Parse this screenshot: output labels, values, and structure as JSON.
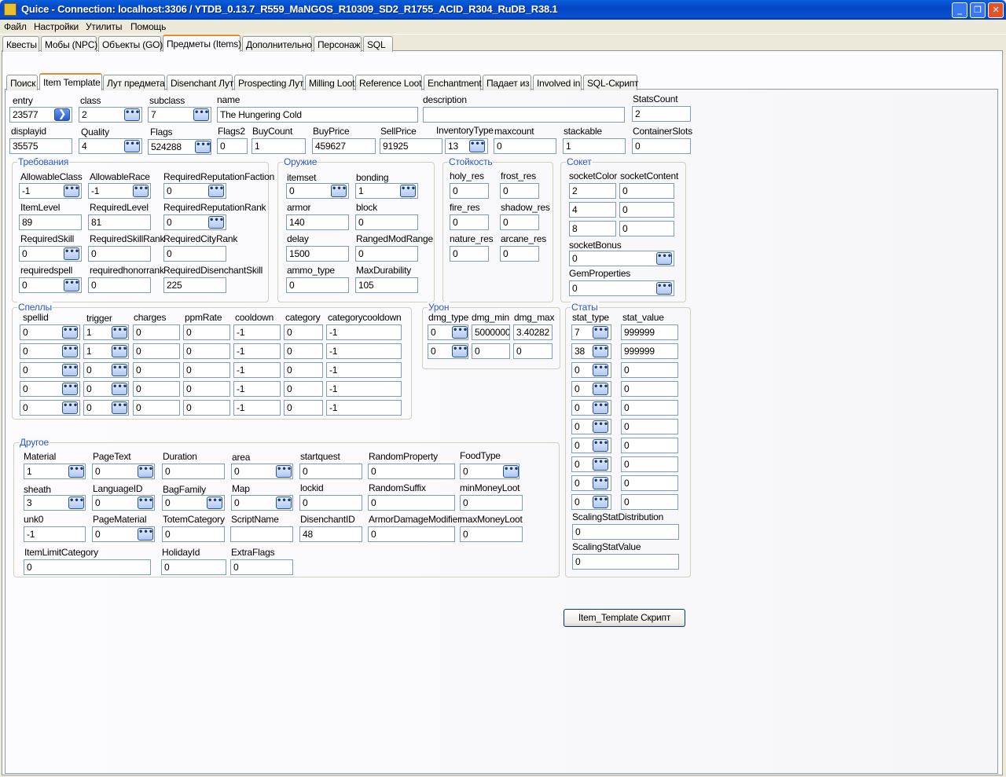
{
  "window": {
    "title": "Quice - Connection: localhost:3306 / YTDB_0.13.7_R559_MaNGOS_R10309_SD2_R1755_ACID_R304_RuDB_R38.1",
    "minimize_glyph": "_",
    "maximize_glyph": "❐",
    "close_glyph": "✕"
  },
  "menu": [
    "Файл",
    "Настройки",
    "Утилиты",
    "Помощь"
  ],
  "main_tabs": [
    "Квесты",
    "Мобы (NPC)",
    "Объекты (GO)",
    "Предметы (Items)",
    "Дополнительно",
    "Персонаж",
    "SQL"
  ],
  "main_tab_active": "Предметы (Items)",
  "sub_tabs": [
    "Поиск",
    "Item Template",
    "Лут предмета",
    "Disenchant Лут",
    "Prospecting Лут",
    "Milling Loot",
    "Reference Loot",
    "Enchantment",
    "Падает из",
    "Involved in",
    "SQL-Скрипт"
  ],
  "sub_tab_active": "Item Template",
  "icons": {
    "picker": "ellipsis-button-icon",
    "go": "arrow-go-icon"
  },
  "button_glyphs": {
    "picker": "•••",
    "go": "❯"
  },
  "header": {
    "entry_label": "entry",
    "entry": "23577",
    "class_label": "class",
    "class": "2",
    "subclass_label": "subclass",
    "subclass": "7",
    "name_label": "name",
    "name": "The Hungering Cold",
    "description_label": "description",
    "description": "",
    "statscount_label": "StatsCount",
    "statscount": "2",
    "displayid_label": "displayid",
    "displayid": "35575",
    "quality_label": "Quality",
    "quality": "4",
    "flags_label": "Flags",
    "flags": "524288",
    "flags2_label": "Flags2",
    "flags2": "0",
    "buycount_label": "BuyCount",
    "buycount": "1",
    "buyprice_label": "BuyPrice",
    "buyprice": "459627",
    "sellprice_label": "SellPrice",
    "sellprice": "91925",
    "inventorytype_label": "InventoryType",
    "inventorytype": "13",
    "maxcount_label": "maxcount",
    "maxcount": "0",
    "stackable_label": "stackable",
    "stackable": "1",
    "containerslots_label": "ContainerSlots",
    "containerslots": "0"
  },
  "requirements": {
    "title": "Требования",
    "allowableclass_label": "AllowableClass",
    "allowableclass": "-1",
    "allowablerace_label": "AllowableRace",
    "allowablerace": "-1",
    "reqrepfaction_label": "RequiredReputationFaction",
    "reqrepfaction": "0",
    "itemlevel_label": "ItemLevel",
    "itemlevel": "89",
    "requiredlevel_label": "RequiredLevel",
    "requiredlevel": "81",
    "reqreprank_label": "RequiredReputationRank",
    "reqreprank": "0",
    "requiredskill_label": "RequiredSkill",
    "requiredskill": "0",
    "requiredskillrank_label": "RequiredSkillRank",
    "requiredskillrank": "0",
    "requiredcityrank_label": "RequiredCityRank",
    "requiredcityrank": "0",
    "requiredspell_label": "requiredspell",
    "requiredspell": "0",
    "requiredhonorrank_label": "requiredhonorrank",
    "requiredhonorrank": "0",
    "reqdisenchantskill_label": "RequiredDisenchantSkill",
    "reqdisenchantskill": "225"
  },
  "weapon": {
    "title": "Оружие",
    "itemset_label": "itemset",
    "itemset": "0",
    "bonding_label": "bonding",
    "bonding": "1",
    "armor_label": "armor",
    "armor": "140",
    "block_label": "block",
    "block": "0",
    "delay_label": "delay",
    "delay": "1500",
    "rangedmodrange_label": "RangedModRange",
    "rangedmodrange": "0",
    "ammo_type_label": "ammo_type",
    "ammo_type": "0",
    "maxdurability_label": "MaxDurability",
    "maxdurability": "105"
  },
  "resist": {
    "title": "Стойкость",
    "holy_label": "holy_res",
    "holy": "0",
    "frost_label": "frost_res",
    "frost": "0",
    "fire_label": "fire_res",
    "fire": "0",
    "shadow_label": "shadow_res",
    "shadow": "0",
    "nature_label": "nature_res",
    "nature": "0",
    "arcane_label": "arcane_res",
    "arcane": "0"
  },
  "socket": {
    "title": "Сокет",
    "color_label": "socketColor",
    "content_label": "socketContent",
    "rows": [
      {
        "color": "2",
        "content": "0"
      },
      {
        "color": "4",
        "content": "0"
      },
      {
        "color": "8",
        "content": "0"
      }
    ],
    "bonus_label": "socketBonus",
    "bonus": "0",
    "gemprops_label": "GemProperties",
    "gemprops": "0"
  },
  "spells": {
    "title": "Спеллы",
    "headers": [
      "spellid",
      "trigger",
      "charges",
      "ppmRate",
      "cooldown",
      "category",
      "categorycooldown"
    ],
    "rows": [
      {
        "spellid": "0",
        "trigger": "1",
        "charges": "0",
        "ppmrate": "0",
        "cooldown": "-1",
        "category": "0",
        "categorycooldown": "-1"
      },
      {
        "spellid": "0",
        "trigger": "1",
        "charges": "0",
        "ppmrate": "0",
        "cooldown": "-1",
        "category": "0",
        "categorycooldown": "-1"
      },
      {
        "spellid": "0",
        "trigger": "0",
        "charges": "0",
        "ppmrate": "0",
        "cooldown": "-1",
        "category": "0",
        "categorycooldown": "-1"
      },
      {
        "spellid": "0",
        "trigger": "0",
        "charges": "0",
        "ppmrate": "0",
        "cooldown": "-1",
        "category": "0",
        "categorycooldown": "-1"
      },
      {
        "spellid": "0",
        "trigger": "0",
        "charges": "0",
        "ppmrate": "0",
        "cooldown": "-1",
        "category": "0",
        "categorycooldown": "-1"
      }
    ]
  },
  "damage": {
    "title": "Урон",
    "headers": [
      "dmg_type",
      "dmg_min",
      "dmg_max"
    ],
    "rows": [
      {
        "type": "0",
        "min": "5000000",
        "max": "3.40282"
      },
      {
        "type": "0",
        "min": "0",
        "max": "0"
      }
    ]
  },
  "stats": {
    "title": "Статы",
    "headers": [
      "stat_type",
      "stat_value"
    ],
    "rows": [
      {
        "type": "7",
        "value": "999999"
      },
      {
        "type": "38",
        "value": "999999"
      },
      {
        "type": "0",
        "value": "0"
      },
      {
        "type": "0",
        "value": "0"
      },
      {
        "type": "0",
        "value": "0"
      },
      {
        "type": "0",
        "value": "0"
      },
      {
        "type": "0",
        "value": "0"
      },
      {
        "type": "0",
        "value": "0"
      },
      {
        "type": "0",
        "value": "0"
      },
      {
        "type": "0",
        "value": "0"
      }
    ],
    "scalingdist_label": "ScalingStatDistribution",
    "scalingdist": "0",
    "scalingvalue_label": "ScalingStatValue",
    "scalingvalue": "0"
  },
  "other": {
    "title": "Другое",
    "material_label": "Material",
    "material": "1",
    "pagetext_label": "PageText",
    "pagetext": "0",
    "duration_label": "Duration",
    "duration": "0",
    "area_label": "area",
    "area": "0",
    "startquest_label": "startquest",
    "startquest": "0",
    "randomproperty_label": "RandomProperty",
    "randomproperty": "0",
    "foodtype_label": "FoodType",
    "foodtype": "0",
    "sheath_label": "sheath",
    "sheath": "3",
    "languageid_label": "LanguageID",
    "languageid": "0",
    "bagfamily_label": "BagFamily",
    "bagfamily": "0",
    "map_label": "Map",
    "map": "0",
    "lockid_label": "lockid",
    "lockid": "0",
    "randomsuffix_label": "RandomSuffix",
    "randomsuffix": "0",
    "minmoneyloot_label": "minMoneyLoot",
    "minmoneyloot": "0",
    "unk0_label": "unk0",
    "unk0": "-1",
    "pagematerial_label": "PageMaterial",
    "pagematerial": "0",
    "totemcategory_label": "TotemCategory",
    "totemcategory": "0",
    "scriptname_label": "ScriptName",
    "scriptname": "",
    "disenchantid_label": "DisenchantID",
    "disenchantid": "48",
    "armordamagemod_label": "ArmorDamageModifier",
    "armordamagemod": "0",
    "maxmoneyloot_label": "maxMoneyLoot",
    "maxmoneyloot": "0",
    "itemlimitcategory_label": "ItemLimitCategory",
    "itemlimitcategory": "0",
    "holidayid_label": "HolidayId",
    "holidayid": "0",
    "extraflags_label": "ExtraFlags",
    "extraflags": "0"
  },
  "script_button_label": "Item_Template Скрипт"
}
